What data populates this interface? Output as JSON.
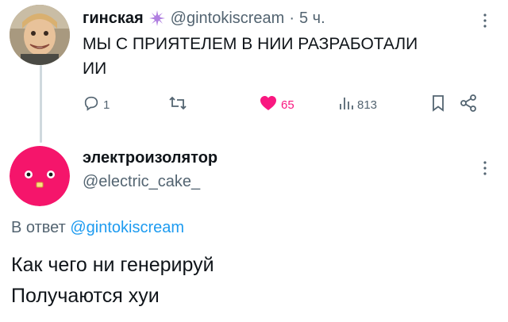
{
  "tweet": {
    "author_name": "гинская",
    "author_handle": "@gintokiscream",
    "separator": "·",
    "time": "5 ч.",
    "text": "МЫ С ПРИЯТЕЛЕМ В НИИ РАЗРАБОТАЛИ ИИ",
    "stats": {
      "replies": "1",
      "likes": "65",
      "views": "813"
    }
  },
  "reply": {
    "author_name": "электроизолятор",
    "author_handle": "@electric_cake_",
    "reply_prefix": "В ответ",
    "reply_mention": "@gintokiscream",
    "lines": [
      "Как чего ни генерируй",
      "Получаются хуи"
    ]
  },
  "colors": {
    "text": "#0f1419",
    "secondary": "#536471",
    "link": "#1d9bf0",
    "like": "#f91880",
    "badge": "#b07fe0"
  },
  "icons": [
    "more-icon",
    "reply-icon",
    "retweet-icon",
    "heart-icon",
    "views-icon",
    "bookmark-icon",
    "share-icon",
    "badge-icon"
  ]
}
